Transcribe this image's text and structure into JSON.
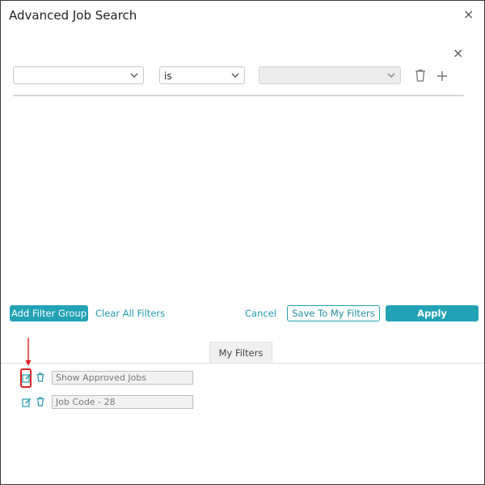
{
  "dialog": {
    "title": "Advanced Job Search",
    "close_symbol": "×",
    "row_close_symbol": "×"
  },
  "filter_row": {
    "field_value": "",
    "operator_value": "is",
    "value_value": ""
  },
  "actions": {
    "add_filter_group": "Add Filter Group",
    "clear_all_filters": "Clear All Filters",
    "cancel": "Cancel",
    "save_to_my_filters": "Save To My Filters",
    "apply": "Apply"
  },
  "my_filters": {
    "tab_label": "My Filters",
    "items": [
      {
        "name": "Show Approved Jobs"
      },
      {
        "name": "Job Code - 28"
      }
    ]
  },
  "colors": {
    "accent": "#22a2b4",
    "highlight": "#e02020"
  }
}
